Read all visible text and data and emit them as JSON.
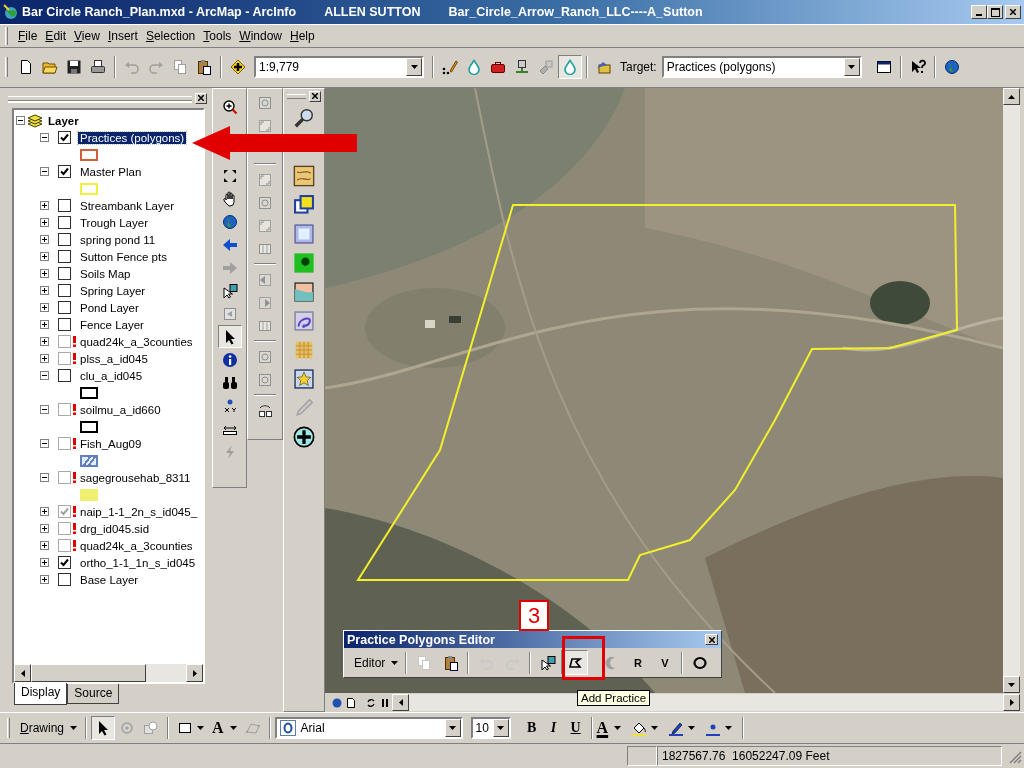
{
  "window": {
    "title": "Bar Circle Ranch_Plan.mxd - ArcMap - ArcInfo",
    "user": "ALLEN SUTTON",
    "project": "Bar_Circle_Arrow_Ranch_LLC----A_Sutton"
  },
  "menu": [
    "File",
    "Edit",
    "View",
    "Insert",
    "Selection",
    "Tools",
    "Window",
    "Help"
  ],
  "standard_toolbar": {
    "scale": "1:9,779",
    "target_label": "Target:",
    "target": "Practices (polygons)"
  },
  "toc": {
    "tree": {
      "name": "Layer",
      "expanded": true,
      "children": [
        {
          "name": "Practices (polygons)",
          "checked": true,
          "expanded": true,
          "warning": false,
          "dimmed": false,
          "selected": true,
          "legend": {
            "kind": "outline",
            "color": "#d0603a"
          }
        },
        {
          "name": "Master Plan",
          "checked": true,
          "expanded": true,
          "warning": false,
          "dimmed": false,
          "selected": false,
          "legend": {
            "kind": "outline",
            "color": "#f0f040"
          }
        },
        {
          "name": "Streambank Layer",
          "checked": false,
          "expanded": false,
          "warning": false,
          "dimmed": false,
          "selected": false
        },
        {
          "name": "Trough Layer",
          "checked": false,
          "expanded": false,
          "warning": false,
          "dimmed": false,
          "selected": false
        },
        {
          "name": "spring pond 11",
          "checked": false,
          "expanded": false,
          "warning": false,
          "dimmed": false,
          "selected": false
        },
        {
          "name": "Sutton Fence pts",
          "checked": false,
          "expanded": false,
          "warning": false,
          "dimmed": false,
          "selected": false
        },
        {
          "name": "Soils Map",
          "checked": false,
          "expanded": false,
          "warning": false,
          "dimmed": false,
          "selected": false
        },
        {
          "name": "Spring Layer",
          "checked": false,
          "expanded": false,
          "warning": false,
          "dimmed": false,
          "selected": false
        },
        {
          "name": "Pond Layer",
          "checked": false,
          "expanded": false,
          "warning": false,
          "dimmed": false,
          "selected": false
        },
        {
          "name": "Fence Layer",
          "checked": false,
          "expanded": false,
          "warning": false,
          "dimmed": false,
          "selected": false
        },
        {
          "name": "quad24k_a_3counties",
          "checked": false,
          "expanded": false,
          "warning": true,
          "dimmed": true,
          "selected": false
        },
        {
          "name": "plss_a_id045",
          "checked": false,
          "expanded": false,
          "warning": true,
          "dimmed": true,
          "selected": false
        },
        {
          "name": "clu_a_id045",
          "checked": false,
          "expanded": true,
          "warning": false,
          "dimmed": false,
          "selected": false,
          "legend": {
            "kind": "outline",
            "color": "#000000"
          }
        },
        {
          "name": "soilmu_a_id660",
          "checked": false,
          "expanded": true,
          "warning": true,
          "dimmed": true,
          "selected": false,
          "legend": {
            "kind": "outline",
            "color": "#000000"
          }
        },
        {
          "name": "Fish_Aug09",
          "checked": false,
          "expanded": true,
          "warning": true,
          "dimmed": true,
          "selected": false,
          "legend": {
            "kind": "hatch",
            "color": "#6080c0"
          }
        },
        {
          "name": "sagegrousehab_8311",
          "checked": false,
          "expanded": true,
          "warning": true,
          "dimmed": true,
          "selected": false,
          "legend": {
            "kind": "fill",
            "color": "#f0f070"
          }
        },
        {
          "name": "naip_1-1_2n_s_id045_",
          "checked": true,
          "expanded": false,
          "warning": true,
          "dimmed": true,
          "selected": false
        },
        {
          "name": "drg_id045.sid",
          "checked": false,
          "expanded": false,
          "warning": true,
          "dimmed": true,
          "selected": false
        },
        {
          "name": "quad24k_a_3counties",
          "checked": false,
          "expanded": false,
          "warning": true,
          "dimmed": true,
          "selected": false
        },
        {
          "name": "ortho_1-1_1n_s_id045",
          "checked": true,
          "expanded": false,
          "warning": false,
          "dimmed": false,
          "selected": false
        },
        {
          "name": "Base Layer",
          "checked": false,
          "expanded": false,
          "warning": false,
          "dimmed": false,
          "selected": false
        }
      ]
    },
    "tabs": [
      {
        "label": "Display",
        "selected": true
      },
      {
        "label": "Source",
        "selected": false
      }
    ]
  },
  "callout": {
    "step": "3"
  },
  "editor": {
    "title": "Practice Polygons Editor",
    "menu": "Editor",
    "tool_groups": [
      [
        {
          "kind": "copy",
          "disabled": true,
          "pressed": false
        },
        {
          "kind": "paste",
          "disabled": false,
          "pressed": false
        }
      ],
      [
        {
          "kind": "undo",
          "disabled": true,
          "pressed": false
        },
        {
          "kind": "redo",
          "disabled": true,
          "pressed": false
        }
      ],
      [
        {
          "kind": "edit",
          "disabled": false,
          "pressed": false
        },
        {
          "kind": "sketch",
          "disabled": false,
          "pressed": true
        },
        {
          "kind": "cut",
          "disabled": true,
          "pressed": false
        },
        {
          "kind": "letter",
          "label": "R",
          "disabled": false,
          "pressed": false
        },
        {
          "kind": "letter",
          "label": "V",
          "disabled": false,
          "pressed": false
        }
      ],
      [
        {
          "kind": "circle",
          "disabled": false,
          "pressed": false
        }
      ]
    ]
  },
  "tooltip": "Add Practice",
  "drawing_toolbar": {
    "menu": "Drawing",
    "text_tool": "A",
    "font": "Arial",
    "font_size": "10",
    "bold": "B",
    "italic": "I",
    "underline": "U",
    "font_color": "A"
  },
  "status_bar": {
    "coordinates": "1827567.76  16052247.09 Feet"
  }
}
